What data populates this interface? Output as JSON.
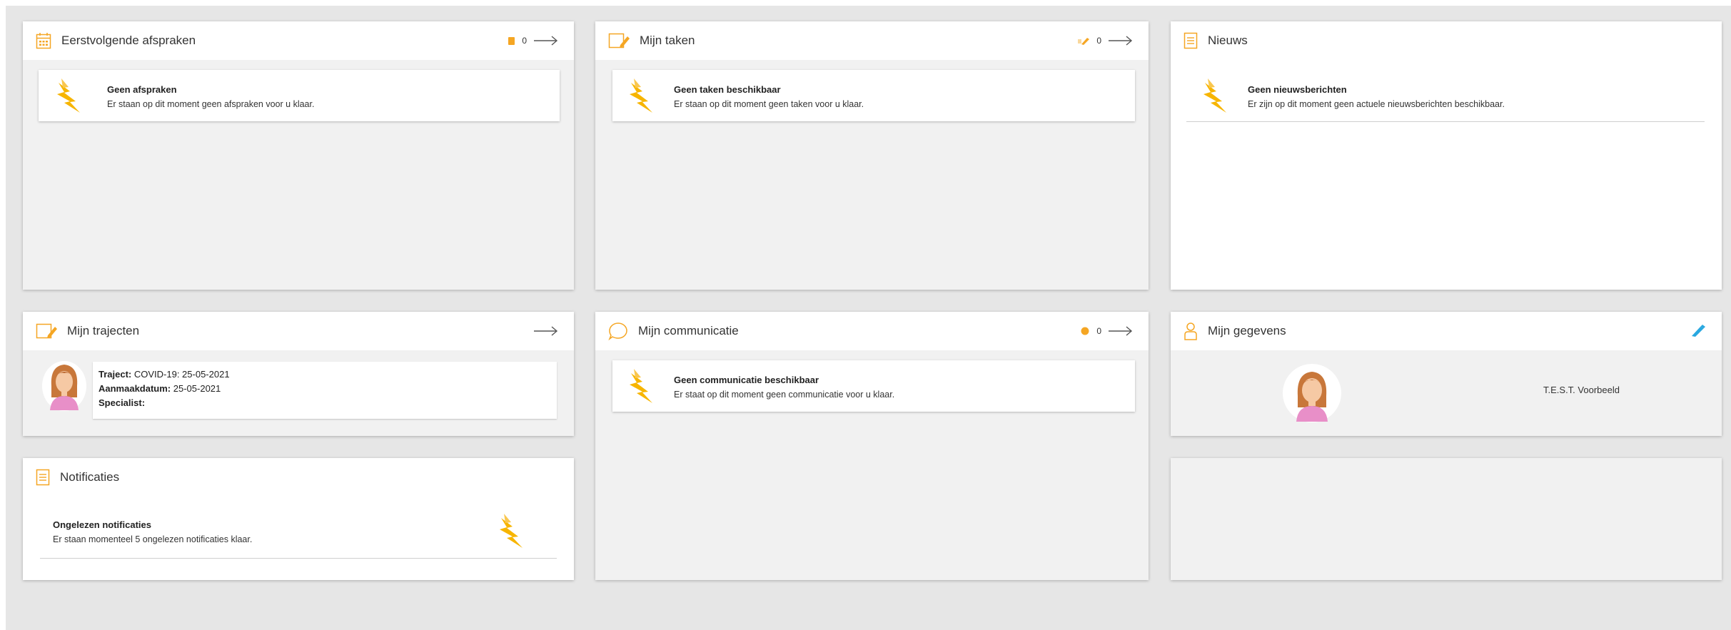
{
  "colors": {
    "accent": "#f5a623",
    "bolt": "#f7b500",
    "edit": "#29a8e0"
  },
  "appointments": {
    "title": "Eerstvolgende afspraken",
    "count": "0",
    "empty_title": "Geen afspraken",
    "empty_text": "Er staan op dit moment geen afspraken voor u klaar."
  },
  "tasks": {
    "title": "Mijn taken",
    "count": "0",
    "empty_title": "Geen taken beschikbaar",
    "empty_text": "Er staan op dit moment geen taken voor u klaar."
  },
  "news": {
    "title": "Nieuws",
    "empty_title": "Geen nieuwsberichten",
    "empty_text": "Er zijn op dit moment geen actuele nieuwsberichten beschikbaar."
  },
  "trajectories": {
    "title": "Mijn trajecten",
    "traject_label": "Traject:",
    "traject_value": "COVID-19: 25-05-2021",
    "created_label": "Aanmaakdatum:",
    "created_value": "25-05-2021",
    "specialist_label": "Specialist:",
    "specialist_value": ""
  },
  "communication": {
    "title": "Mijn communicatie",
    "count": "0",
    "empty_title": "Geen communicatie beschikbaar",
    "empty_text": "Er staat op dit moment geen communicatie voor u klaar."
  },
  "profile": {
    "title": "Mijn gegevens",
    "name": "T.E.S.T. Voorbeeld"
  },
  "notifications": {
    "title": "Notificaties",
    "unread_title": "Ongelezen notificaties",
    "unread_text": "Er staan momenteel 5 ongelezen notificaties klaar."
  }
}
